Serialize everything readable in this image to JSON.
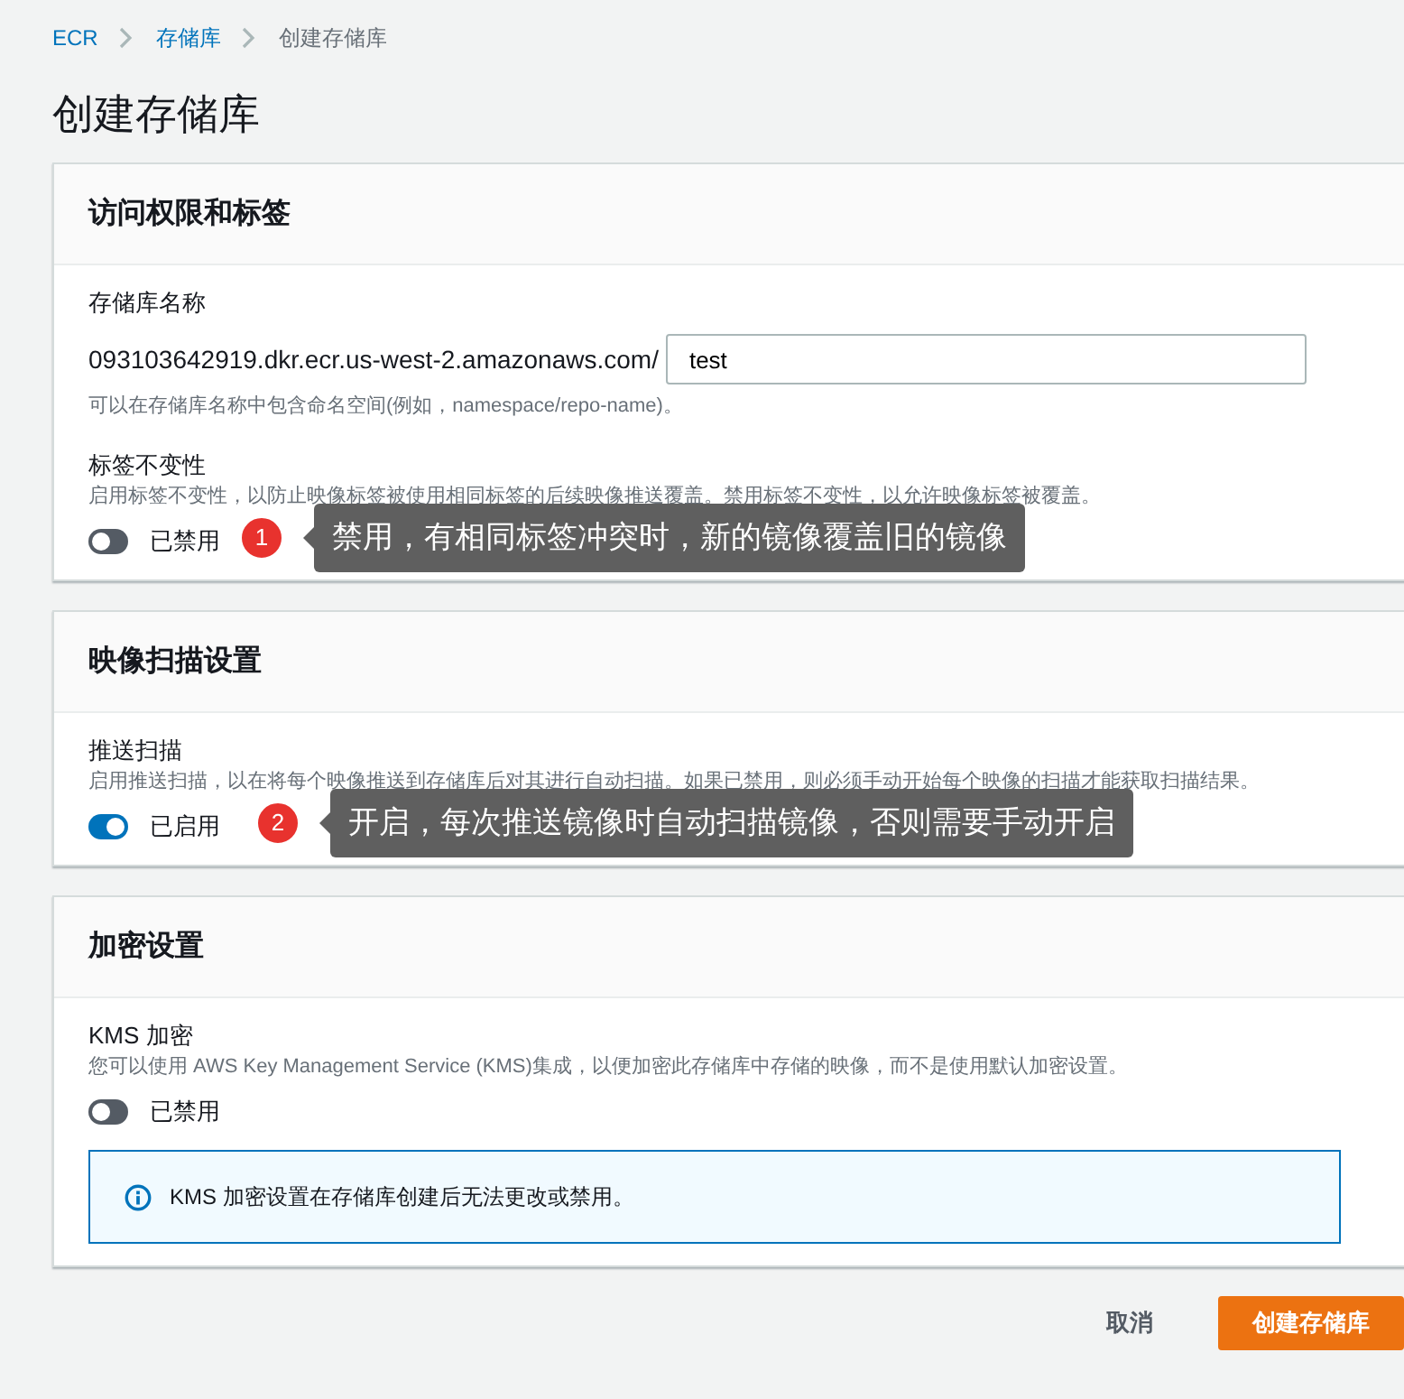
{
  "breadcrumb": [
    {
      "label": "ECR",
      "kind": "link"
    },
    {
      "label": "存储库",
      "kind": "link"
    },
    {
      "label": "创建存储库",
      "kind": "current"
    }
  ],
  "title": "创建存储库",
  "sections": [
    {
      "title": "访问权限和标签",
      "fields": [
        {
          "kind": "text_input",
          "label": "存储库名称",
          "prefix": "093103642919.dkr.ecr.us-west-2.amazonaws.com/",
          "value": "test",
          "hint": "可以在存储库名称中包含命名空间(例如，namespace/repo-name)。"
        },
        {
          "kind": "toggle",
          "label": "标签不变性",
          "description": "启用标签不变性，以防止映像标签被使用相同标签的后续映像推送覆盖。禁用标签不变性，以允许映像标签被覆盖。",
          "on": false,
          "state_label": "已禁用",
          "annotation": {
            "number": "1",
            "text": "禁用，有相同标签冲突时，新的镜像覆盖旧的镜像"
          }
        }
      ]
    },
    {
      "title": "映像扫描设置",
      "fields": [
        {
          "kind": "toggle",
          "label": "推送扫描",
          "description": "启用推送扫描，以在将每个映像推送到存储库后对其进行自动扫描。如果已禁用，则必须手动开始每个映像的扫描才能获取扫描结果。",
          "on": true,
          "state_label": "已启用",
          "annotation": {
            "number": "2",
            "text": "开启，每次推送镜像时自动扫描镜像，否则需要手动开启"
          }
        }
      ]
    },
    {
      "title": "加密设置",
      "fields": [
        {
          "kind": "toggle",
          "label": "KMS 加密",
          "description": "您可以使用 AWS Key Management Service (KMS)集成，以便加密此存储库中存储的映像，而不是使用默认加密设置。",
          "on": false,
          "state_label": "已禁用"
        },
        {
          "kind": "info",
          "text": "KMS 加密设置在存储库创建后无法更改或禁用。"
        }
      ]
    }
  ],
  "buttons": [
    {
      "label": "取消",
      "kind": "link"
    },
    {
      "label": "创建存储库",
      "kind": "primary"
    }
  ]
}
